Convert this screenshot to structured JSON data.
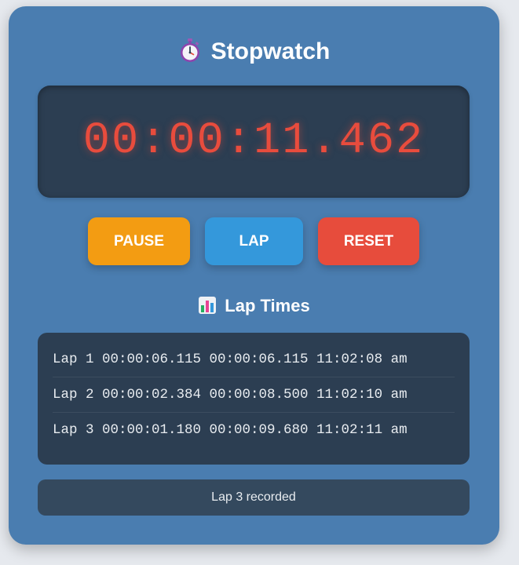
{
  "header": {
    "icon": "stopwatch-icon",
    "title": "Stopwatch"
  },
  "display": {
    "time": "00:00:11.462",
    "color": "#e84c3d"
  },
  "controls": {
    "pause_label": "PAUSE",
    "pause_color": "#f39c12",
    "lap_label": "LAP",
    "lap_color": "#3498db",
    "reset_label": "RESET",
    "reset_color": "#e74c3c"
  },
  "laps": {
    "icon": "bar-chart-icon",
    "heading": "Lap Times",
    "rows": [
      "Lap 1 00:00:06.115 00:00:06.115 11:02:08 am",
      "Lap 2 00:00:02.384 00:00:08.500 11:02:10 am",
      "Lap 3 00:00:01.180 00:00:09.680 11:02:11 am"
    ]
  },
  "status": {
    "message": "Lap 3 recorded"
  },
  "theme": {
    "card_background": "#4a7db0",
    "panel_background": "#2c3e52"
  }
}
